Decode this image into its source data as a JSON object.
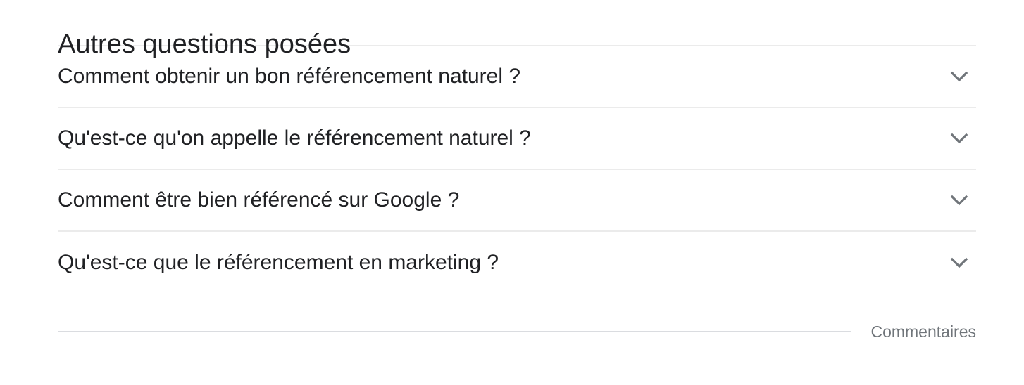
{
  "section": {
    "title": "Autres questions posées",
    "questions": [
      {
        "text": "Comment obtenir un bon référencement naturel ?",
        "icon": "chevron-down-icon"
      },
      {
        "text": "Qu'est-ce qu'on appelle le référencement naturel ?",
        "icon": "chevron-down-icon"
      },
      {
        "text": "Comment être bien référencé sur Google ?",
        "icon": "chevron-down-icon"
      },
      {
        "text": "Qu'est-ce que le référencement en marketing ?",
        "icon": "chevron-down-icon"
      }
    ]
  },
  "footer": {
    "feedback_label": "Commentaires"
  },
  "colors": {
    "text": "#202124",
    "chevron": "#70757a",
    "divider": "#ebebeb",
    "feedback": "#70757a"
  }
}
